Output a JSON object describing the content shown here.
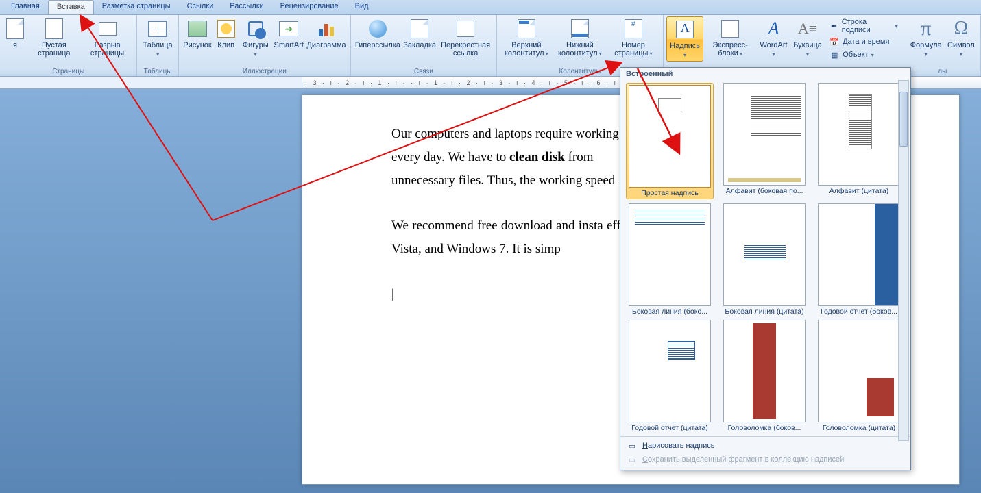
{
  "tabs": [
    "Главная",
    "Вставка",
    "Разметка страницы",
    "Ссылки",
    "Рассылки",
    "Рецензирование",
    "Вид"
  ],
  "active_tab_index": 1,
  "ribbon": {
    "pages": {
      "label": "Страницы",
      "cover": "я",
      "blank": "Пустая страница",
      "break": "Разрыв страницы"
    },
    "tables": {
      "label": "Таблицы",
      "table": "Таблица"
    },
    "illus": {
      "label": "Иллюстрации",
      "pic": "Рисунок",
      "clip": "Клип",
      "shapes": "Фигуры",
      "smartart": "SmartArt",
      "chart": "Диаграмма"
    },
    "links": {
      "label": "Связи",
      "hyper": "Гиперссылка",
      "bookmark": "Закладка",
      "xref": "Перекрестная ссылка"
    },
    "headfoot": {
      "label": "Колонтитулы",
      "header": "Верхний колонтитул",
      "footer": "Нижний колонтитул",
      "pageno": "Номер страницы"
    },
    "text": {
      "textbox": "Надпись",
      "quick": "Экспресс-блоки",
      "wordart": "WordArt",
      "dropcap": "Буквица",
      "sig": "Строка подписи",
      "date": "Дата и время",
      "obj": "Объект"
    },
    "symbols": {
      "label": "лы",
      "formula": "Формула",
      "symbol": "Символ"
    }
  },
  "ruler_text": "· 3 · ı · 2 · ı · 1 · ı ·   · ı · 1 · ı · 2 · ı · 3 · ı · 4 · ı · 5 · ı · 6 · ı · 7 · ı · 8 · ı                                                  · 17 · ı",
  "document": {
    "p1a": "Our computers and laptops require working",
    "p1b": "every day. We have to ",
    "p1bold": "clean disk",
    "p1c": " from ",
    "p1d": "unnecessary files. Thus, the working speed",
    "p2": "We recommend free download and insta   efficiency independently. It does for suc   Windows Vista, and Windows 7. It is simp"
  },
  "gallery": {
    "heading": "Встроенный",
    "items": [
      {
        "cap": "Простая надпись",
        "sel": true
      },
      {
        "cap": "Алфавит (боковая по..."
      },
      {
        "cap": "Алфавит (цитата)"
      },
      {
        "cap": "Боковая линия (боко..."
      },
      {
        "cap": "Боковая линия (цитата)"
      },
      {
        "cap": "Годовой отчет (боков..."
      },
      {
        "cap": "Годовой отчет (цитата)"
      },
      {
        "cap": "Головоломка (боков..."
      },
      {
        "cap": "Головоломка (цитата)"
      }
    ],
    "footer_draw": "Нарисовать надпись",
    "footer_save": "Сохранить выделенный фрагмент в коллекцию надписей"
  }
}
